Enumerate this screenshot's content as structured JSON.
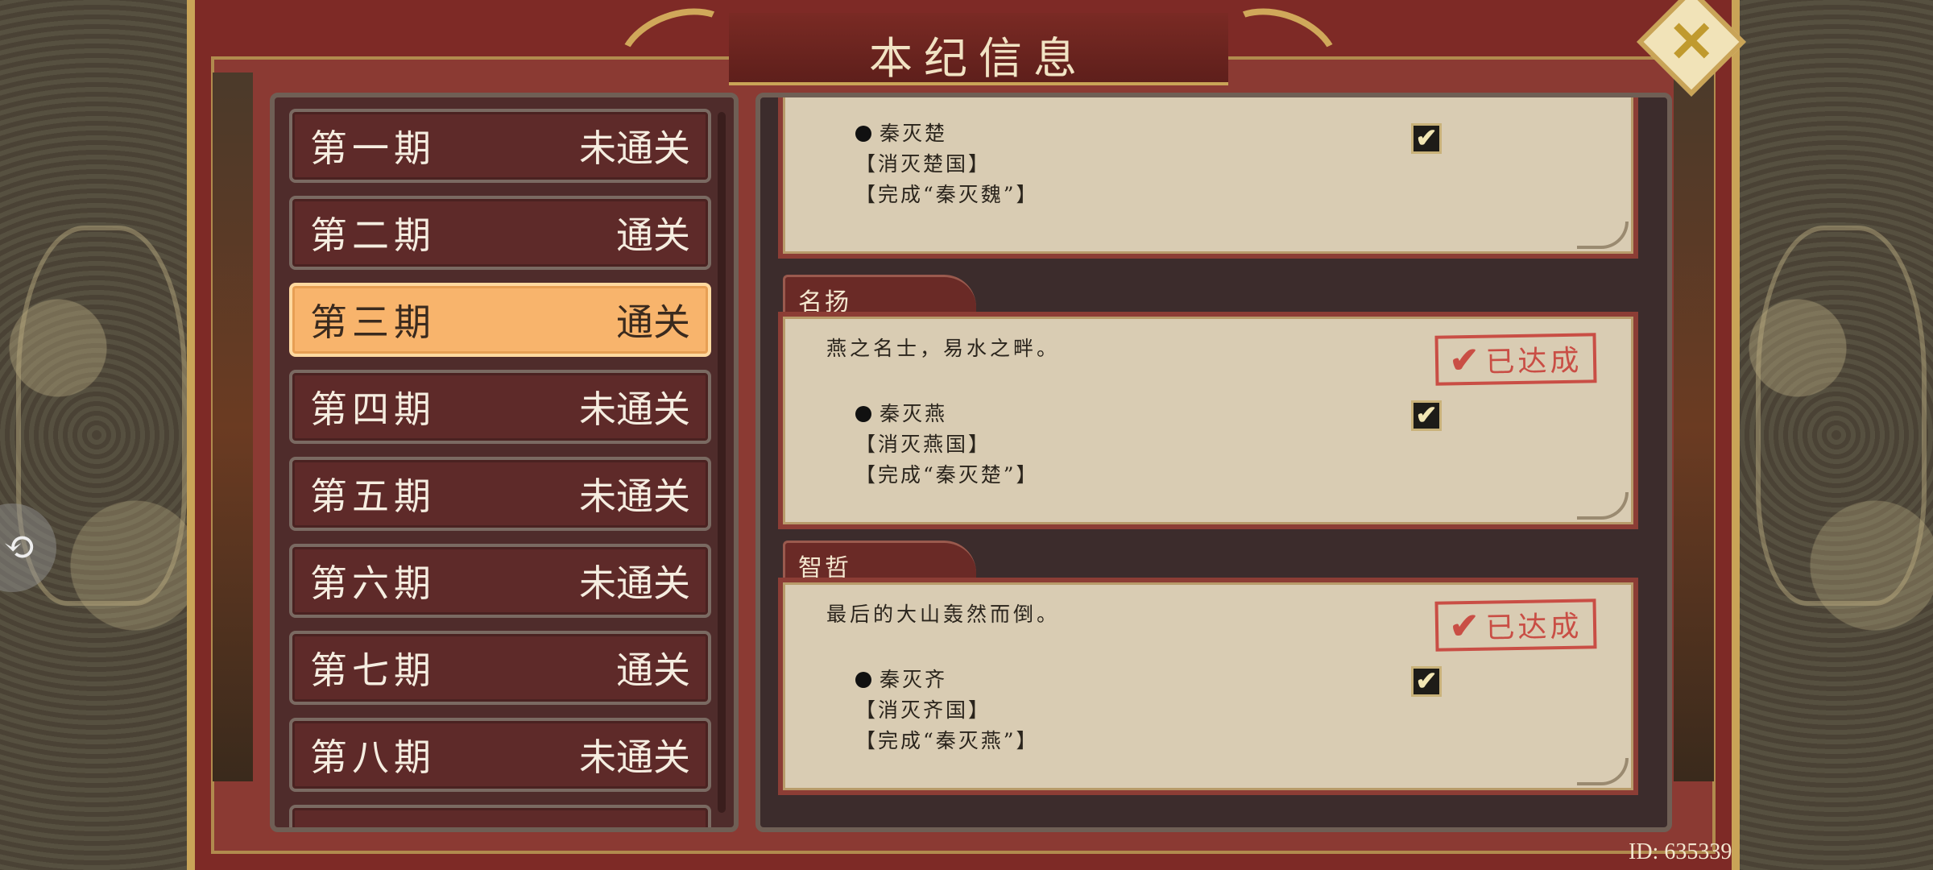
{
  "title": "本纪信息",
  "close_icon": "close-x-icon",
  "periods": [
    {
      "name": "第一期",
      "status": "未通关"
    },
    {
      "name": "第二期",
      "status": "通关"
    },
    {
      "name": "第三期",
      "status": "通关",
      "selected": true
    },
    {
      "name": "第四期",
      "status": "未通关"
    },
    {
      "name": "第五期",
      "status": "未通关"
    },
    {
      "name": "第六期",
      "status": "未通关"
    },
    {
      "name": "第七期",
      "status": "通关"
    },
    {
      "name": "第八期",
      "status": "未通关"
    }
  ],
  "cards": [
    {
      "tab": "",
      "description": "",
      "stamp": "",
      "condition": "秦灭楚",
      "lines": [
        "【消灭楚国】",
        "【完成“秦灭魏”】"
      ],
      "checked": true
    },
    {
      "tab": "名扬",
      "description": "燕之名士，易水之畔。",
      "stamp": "已达成",
      "condition": "秦灭燕",
      "lines": [
        "【消灭燕国】",
        "【完成“秦灭楚”】"
      ],
      "checked": true
    },
    {
      "tab": "智哲",
      "description": "最后的大山轰然而倒。",
      "stamp": "已达成",
      "condition": "秦灭齐",
      "lines": [
        "【消灭齐国】",
        "【完成“秦灭燕”】"
      ],
      "checked": true
    }
  ],
  "checkmark": "✔",
  "stamp_tick": "✔",
  "footer_id": "ID: 635339",
  "colors": {
    "frame_red": "#7e2a26",
    "gold": "#c9a457",
    "active_period": "#f8b46c",
    "stamp_red": "#c8413a"
  }
}
